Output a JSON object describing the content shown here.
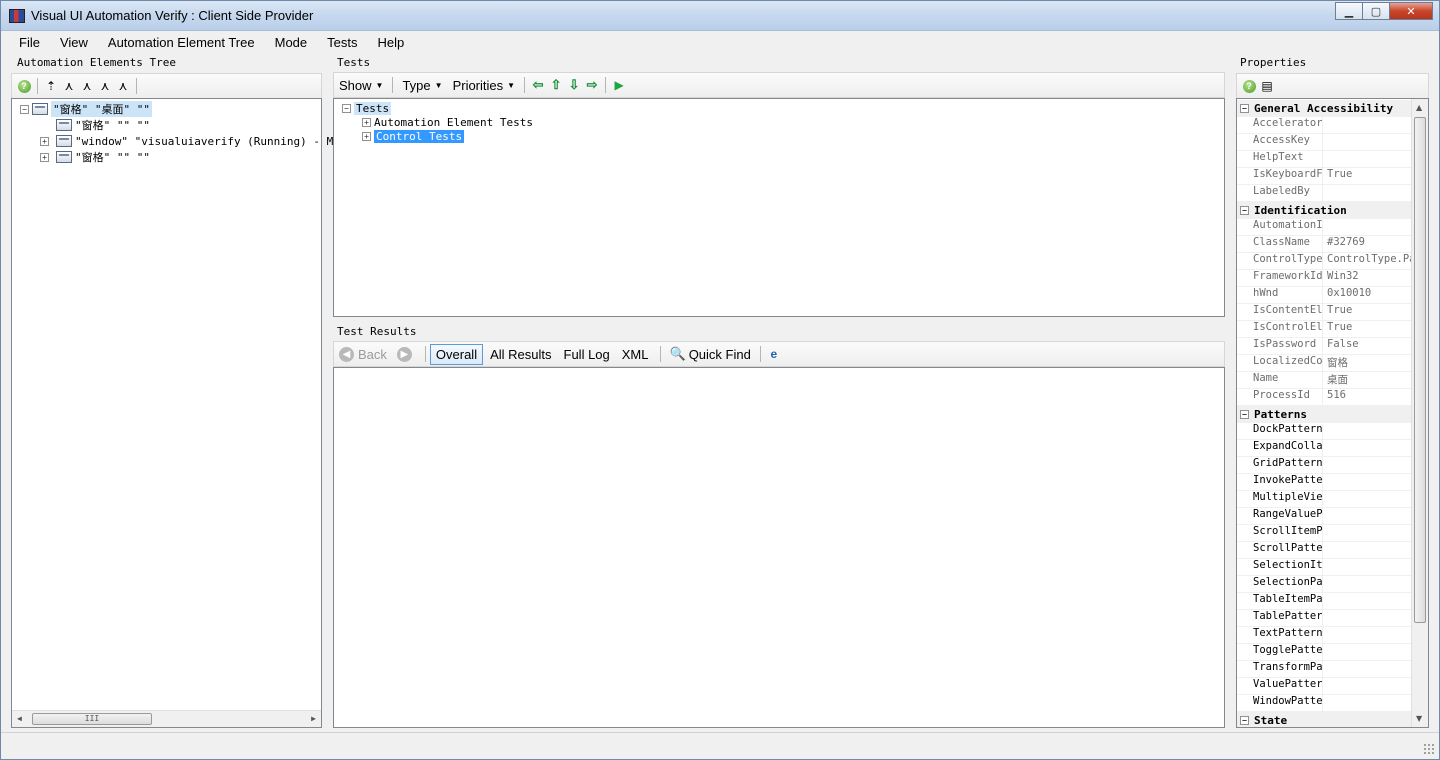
{
  "window": {
    "title": "Visual UI Automation Verify : Client Side Provider"
  },
  "menu": [
    "File",
    "View",
    "Automation Element Tree",
    "Mode",
    "Tests",
    "Help"
  ],
  "automation_tree": {
    "label": "Automation Elements Tree",
    "nodes": [
      {
        "text": "\"窗格\" \"桌面\" \"\"",
        "expanded": true,
        "selected": true,
        "level": 0
      },
      {
        "text": "\"窗格\" \"\" \"\"",
        "level": 1,
        "has_children": false
      },
      {
        "text": "\"window\" \"visualuiaverify (Running) - Mic",
        "level": 1,
        "has_children": true
      },
      {
        "text": "\"窗格\" \"\" \"\"",
        "level": 1,
        "has_children": true
      }
    ],
    "hscroll_grip": "III"
  },
  "tests": {
    "label": "Tests",
    "toolbar": {
      "show": "Show",
      "type": "Type",
      "priorities": "Priorities"
    },
    "nodes": [
      {
        "text": "Tests",
        "level": 0
      },
      {
        "text": "Automation Element Tests",
        "level": 1
      },
      {
        "text": "Control Tests",
        "level": 1,
        "selected": true
      }
    ]
  },
  "test_results": {
    "label": "Test Results",
    "toolbar": {
      "back": "Back",
      "overall": "Overall",
      "all_results": "All Results",
      "full_log": "Full Log",
      "xml": "XML",
      "quick_find": "Quick Find"
    }
  },
  "properties": {
    "label": "Properties",
    "categories": {
      "general": "General Accessibility",
      "identification": "Identification",
      "patterns": "Patterns",
      "state": "State"
    },
    "general": [
      {
        "name": "AcceleratorKey",
        "value": ""
      },
      {
        "name": "AccessKey",
        "value": ""
      },
      {
        "name": "HelpText",
        "value": ""
      },
      {
        "name": "IsKeyboardFocusable",
        "value": "True"
      },
      {
        "name": "LabeledBy",
        "value": ""
      }
    ],
    "identification": [
      {
        "name": "AutomationId",
        "value": ""
      },
      {
        "name": "ClassName",
        "value": "#32769"
      },
      {
        "name": "ControlType",
        "value": "ControlType.Pane"
      },
      {
        "name": "FrameworkId",
        "value": "Win32"
      },
      {
        "name": "hWnd",
        "value": "0x10010"
      },
      {
        "name": "IsContentElement",
        "value": "True"
      },
      {
        "name": "IsControlElement",
        "value": "True"
      },
      {
        "name": "IsPassword",
        "value": "False"
      },
      {
        "name": "LocalizedControlType",
        "value": "窗格"
      },
      {
        "name": "Name",
        "value": "桌面"
      },
      {
        "name": "ProcessId",
        "value": "516"
      }
    ],
    "patterns": [
      "DockPattern",
      "ExpandCollapsePattern",
      "GridPattern",
      "InvokePattern",
      "MultipleViewPattern",
      "RangeValuePattern",
      "ScrollItemPattern",
      "ScrollPattern",
      "SelectionItemPattern",
      "SelectionPattern",
      "TableItemPattern",
      "TablePattern",
      "TextPattern",
      "TogglePattern",
      "TransformPattern",
      "ValuePattern",
      "WindowPattern"
    ]
  },
  "colors": {
    "selection": "#3399ff",
    "selection_inactive": "#cce4f7",
    "title_bg": "#c6d8ee"
  }
}
